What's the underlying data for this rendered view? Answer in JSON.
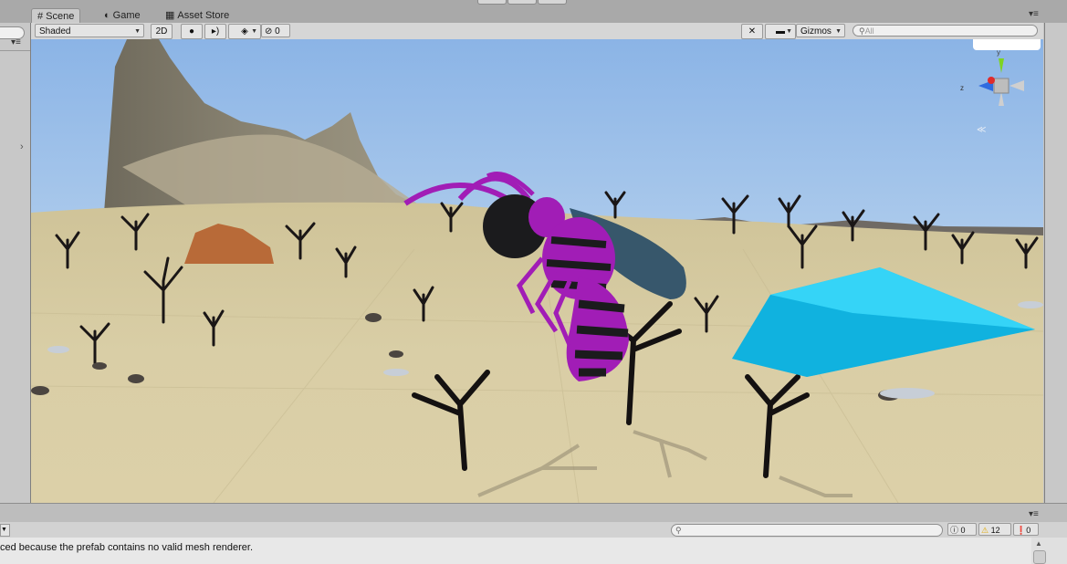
{
  "tabs": [
    {
      "label": "Scene",
      "icon": "grid-icon",
      "active": true
    },
    {
      "label": "Game",
      "icon": "pacman-icon",
      "active": false
    },
    {
      "label": "Asset Store",
      "icon": "store-icon",
      "active": false
    }
  ],
  "toolbar": {
    "shading_mode": "Shaded",
    "mode_2d": "2D",
    "hidden_count": "0",
    "gizmos": "Gizmos",
    "search_placeholder": "All"
  },
  "gizmo": {
    "y_label": "y",
    "z_label": "z"
  },
  "console": {
    "error_count": "0",
    "warning_count": "12",
    "message_count": "0",
    "message": "ced because the prefab contains no valid mesh renderer."
  },
  "colors": {
    "sky_top": "#8fb8e8",
    "sky_horizon": "#c7ddef",
    "sand": "#d8cca2",
    "wasp_purple": "#a11db6",
    "wasp_black": "#1b1b1d",
    "wing": "#264a66",
    "crystal": "#16c3ef"
  }
}
